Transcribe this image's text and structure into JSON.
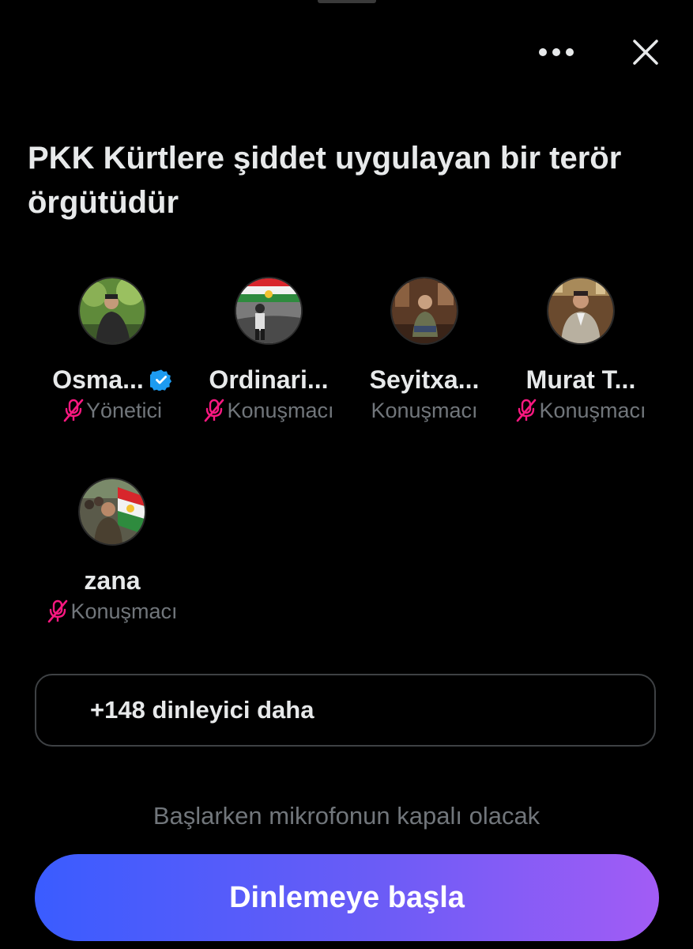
{
  "header": {
    "more_icon": "more-horizontal-icon",
    "close_icon": "close-icon"
  },
  "space": {
    "title": "PKK Kürtlere şiddet uygulayan bir terör örgütüdür"
  },
  "participants": [
    {
      "name": "Osma...",
      "role": "Yönetici",
      "muted": true,
      "verified": true
    },
    {
      "name": "Ordinari...",
      "role": "Konuşmacı",
      "muted": true,
      "verified": false
    },
    {
      "name": "Seyitxa...",
      "role": "Konuşmacı",
      "muted": false,
      "verified": false
    },
    {
      "name": "Murat T...",
      "role": "Konuşmacı",
      "muted": true,
      "verified": false
    },
    {
      "name": "zana",
      "role": "Konuşmacı",
      "muted": true,
      "verified": false
    }
  ],
  "listeners": {
    "label": "+148 dinleyici daha"
  },
  "footer": {
    "mic_note": "Başlarken mikrofonun kapalı olacak",
    "start_button_label": "Dinlemeye başla"
  },
  "colors": {
    "background": "#000000",
    "text_primary": "#e7e9ea",
    "text_secondary": "#71767b",
    "mic_off": "#f91880",
    "verified": "#1d9bf0",
    "button_gradient_start": "#3a5cff",
    "button_gradient_end": "#a25cf5"
  }
}
